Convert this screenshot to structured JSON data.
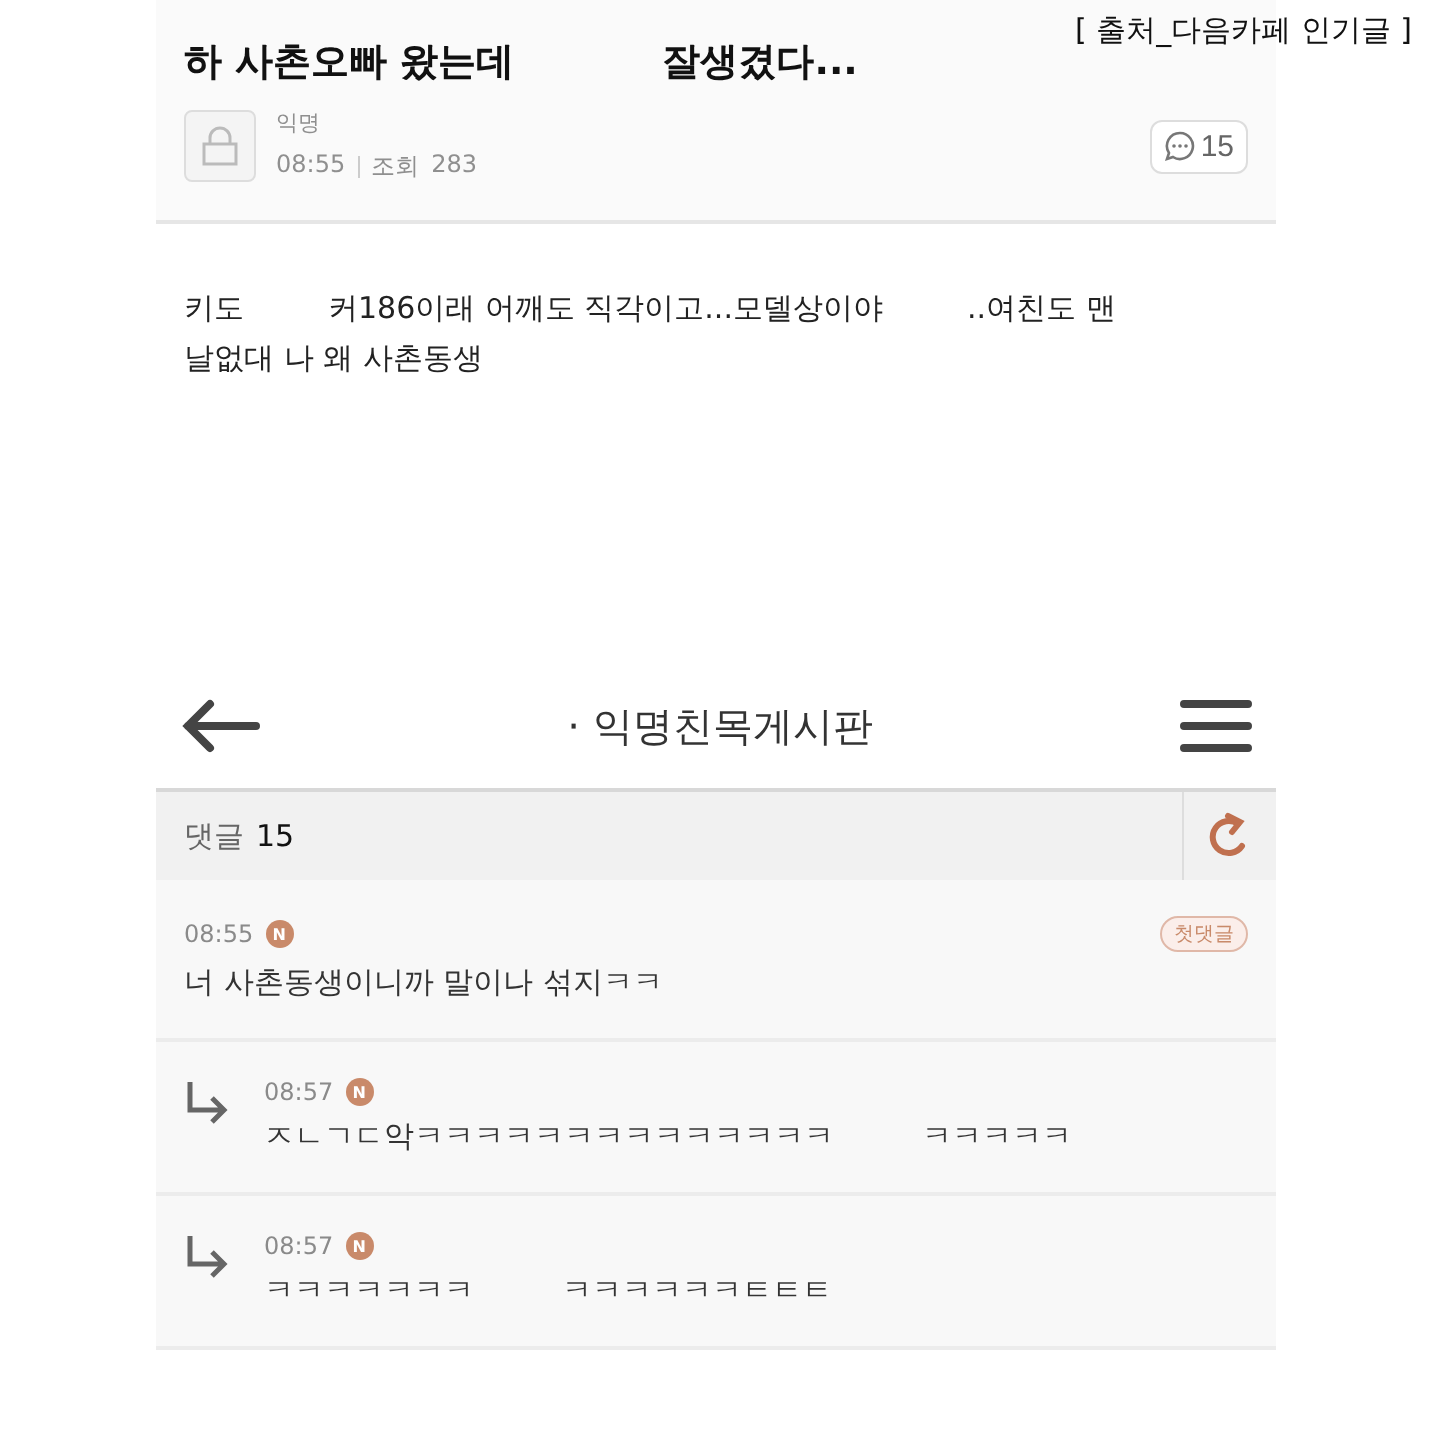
{
  "source_caption": "[ 출처_다음카페 인기글 ]",
  "post": {
    "title_segments": [
      "하 사촌오빠 왔는데",
      "잘생겼다..."
    ],
    "author": "익명",
    "time": "08:55",
    "views_label": "조회",
    "views": "283",
    "comment_count": "15",
    "body_lines": [
      [
        "키도",
        "커186이래 어깨도 직각이고...모델상이야",
        "..여친도 맨"
      ],
      [
        "날없대 나 왜 사촌동생"
      ]
    ]
  },
  "nav": {
    "title": "· 익명친목게시판"
  },
  "comments_header": {
    "label": "댓글",
    "count": "15"
  },
  "comments": [
    {
      "kind": "comment",
      "time": "08:55",
      "new_badge": "N",
      "tag": "첫댓글",
      "segments": [
        "너 사촌동생이니까 말이나 섞지ㅋㅋ"
      ]
    },
    {
      "kind": "reply",
      "time": "08:57",
      "new_badge": "N",
      "segments": [
        "ㅈㄴㄱㄷ악ㅋㅋㅋㅋㅋㅋㅋㅋㅋㅋㅋㅋㅋㅋ",
        "ㅋㅋㅋㅋㅋ"
      ]
    },
    {
      "kind": "reply",
      "time": "08:57",
      "new_badge": "N",
      "segments": [
        "ㅋㅋㅋㅋㅋㅋㅋ",
        "ㅋㅋㅋㅋㅋㅋㅌㅌㅌ"
      ]
    }
  ]
}
